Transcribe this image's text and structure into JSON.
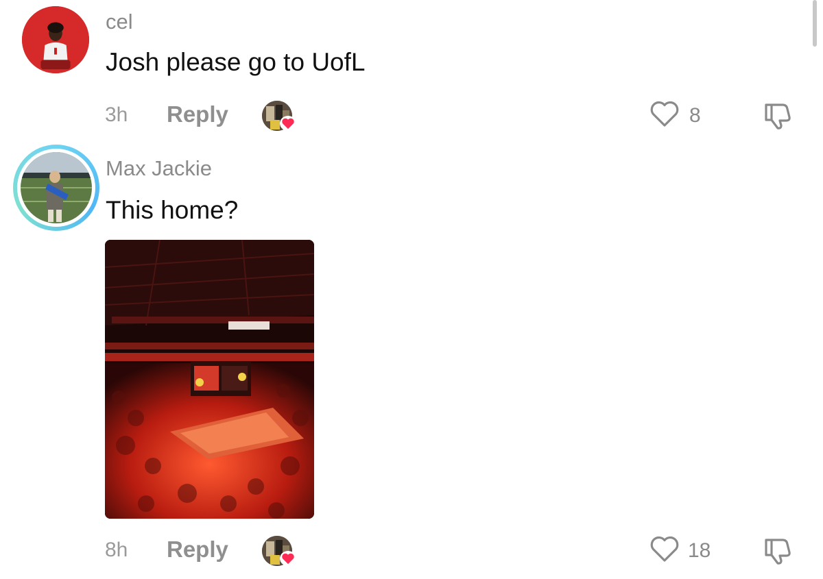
{
  "comments": [
    {
      "username": "cel",
      "text": "Josh please go to UofL",
      "time": "3h",
      "reply_label": "Reply",
      "likes": "8",
      "avatar_icon": "user-avatar-red",
      "creator_liked": true
    },
    {
      "username": "Max Jackie",
      "text": "This home?",
      "time": "8h",
      "reply_label": "Reply",
      "likes": "18",
      "avatar_icon": "user-avatar-story-ring",
      "creator_liked": true,
      "has_photo": true
    }
  ],
  "colors": {
    "username": "#8a8a8a",
    "comment_text": "#111111",
    "meta": "#9a9a9a",
    "heart_red": "#fe2c55",
    "story_ring": "#4fb7f5"
  }
}
